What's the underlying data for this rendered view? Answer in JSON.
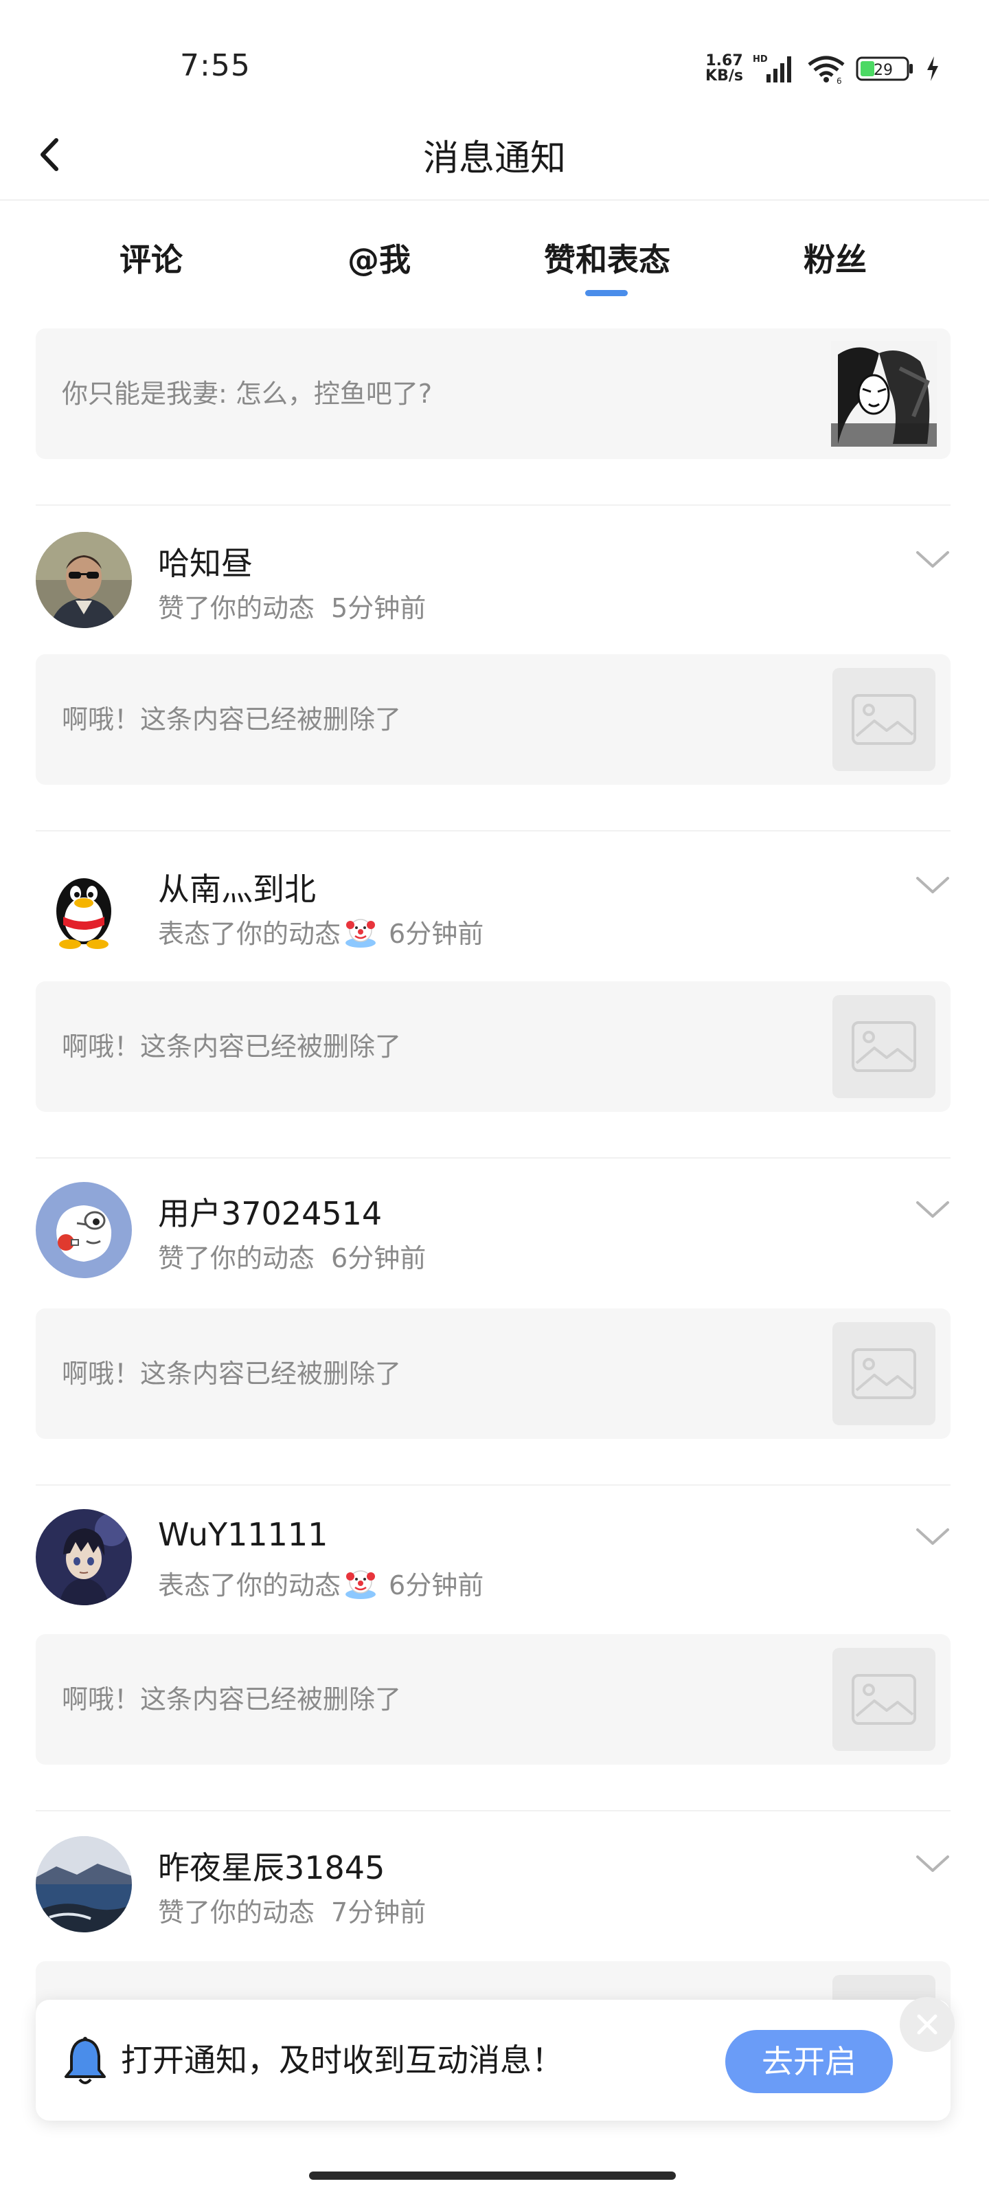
{
  "status_bar": {
    "time": "7:55",
    "net_speed_value": "1.67",
    "net_speed_unit": "KB/s",
    "signal_label": "HD",
    "wifi_label": "6",
    "battery_level": "29",
    "icons": [
      "signal-icon",
      "wifi-icon",
      "battery-icon",
      "charging-icon"
    ]
  },
  "header": {
    "title": "消息通知",
    "back_icon": "chevron-left-icon"
  },
  "tabs": [
    {
      "label": "评论",
      "active": false
    },
    {
      "label": "@我",
      "active": false
    },
    {
      "label": "赞和表态",
      "active": true
    },
    {
      "label": "粉丝",
      "active": false
    }
  ],
  "top_card": {
    "text": "你只能是我妻: 怎么，控鱼吧了?",
    "thumb": "manga-image-thumbnail"
  },
  "notifications": [
    {
      "name": "哈知昼",
      "action": "赞了你的动态",
      "reaction": false,
      "time": "5分钟前",
      "avatar": "man-with-sunglasses-avatar",
      "card_text": "啊哦！这条内容已经被删除了"
    },
    {
      "name": "从南灬到北",
      "action": "表态了你的动态",
      "reaction": true,
      "time": "6分钟前",
      "avatar": "qq-penguin-avatar",
      "card_text": "啊哦！这条内容已经被删除了"
    },
    {
      "name": "用户37024514",
      "action": "赞了你的动态",
      "reaction": false,
      "time": "6分钟前",
      "avatar": "cartoon-character-avatar",
      "card_text": "啊哦！这条内容已经被删除了"
    },
    {
      "name": "WuY11111",
      "action": "表态了你的动态",
      "reaction": true,
      "time": "6分钟前",
      "avatar": "anime-boy-avatar",
      "card_text": "啊哦！这条内容已经被删除了"
    },
    {
      "name": "昨夜星辰31845",
      "action": "赞了你的动态",
      "reaction": false,
      "time": "7分钟前",
      "avatar": "landscape-lake-avatar",
      "card_text": ""
    }
  ],
  "banner": {
    "text": "打开通知，及时收到互动消息！",
    "button_label": "去开启",
    "icon": "bell-icon",
    "close_icon": "close-icon"
  },
  "colors": {
    "accent": "#4a8dea",
    "button": "#6a9cf7",
    "card_bg": "#f6f6f6",
    "secondary_text": "#8a8a8a"
  }
}
